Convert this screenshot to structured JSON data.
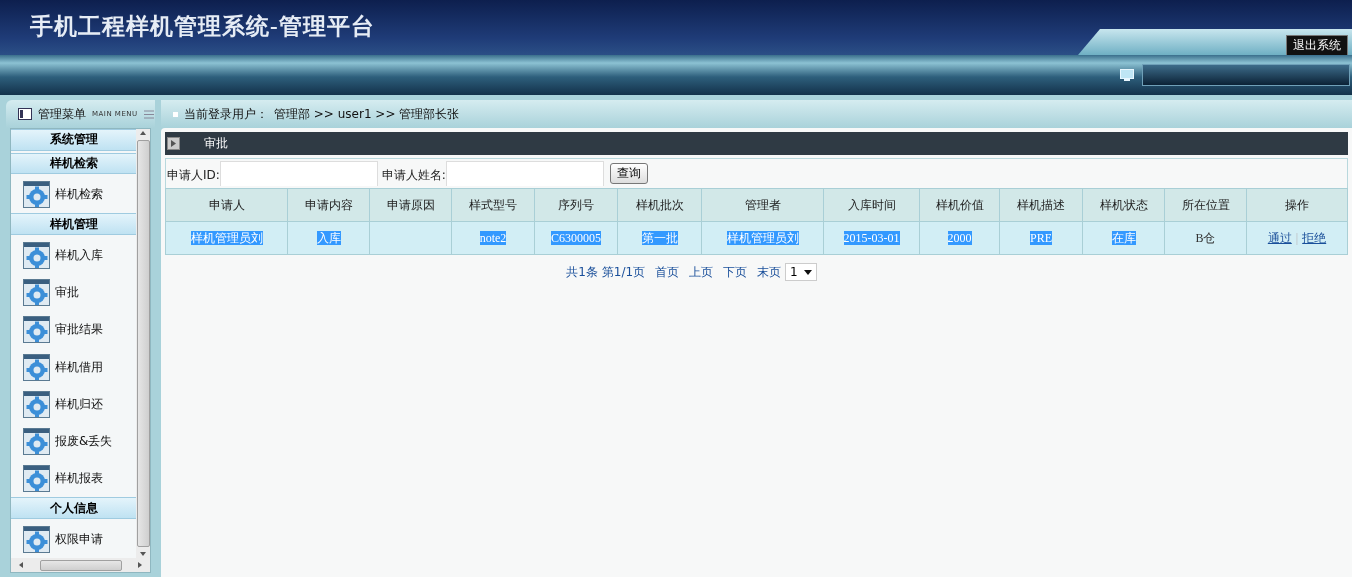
{
  "header": {
    "title": "手机工程样机管理系统-管理平台",
    "logout_button": "退出系统"
  },
  "menu": {
    "title": "管理菜单",
    "subtitle": "MAIN MENU"
  },
  "breadcrumb": {
    "label": "当前登录用户：",
    "path": "管理部  >> user1 >> 管理部长张"
  },
  "sidebar": {
    "sections": [
      {
        "title": "系统管理"
      },
      {
        "title": "样机检索",
        "items": [
          "样机检索"
        ]
      },
      {
        "title": "样机管理",
        "items": [
          "样机入库",
          "审批",
          "审批结果",
          "样机借用",
          "样机归还",
          "报废&丢失",
          "样机报表"
        ]
      },
      {
        "title": "个人信息",
        "items": [
          "权限申请"
        ]
      }
    ]
  },
  "panel": {
    "title": "审批"
  },
  "search": {
    "fields": [
      {
        "label": "申请人ID:"
      },
      {
        "label": "申请人姓名:"
      }
    ],
    "button": "查询"
  },
  "table": {
    "columns": [
      "申请人",
      "申请内容",
      "申请原因",
      "样式型号",
      "序列号",
      "样机批次",
      "管理者",
      "入库时间",
      "样机价值",
      "样机描述",
      "样机状态",
      "所在位置",
      "操作"
    ],
    "rows": [
      {
        "cells": [
          {
            "text": "样机管理员刘",
            "highlighted": true
          },
          {
            "text": "入库",
            "highlighted": true
          },
          {},
          {
            "text": "note2",
            "highlighted": true
          },
          {
            "text": "C6300005",
            "highlighted": true
          },
          {
            "text": "第一批",
            "highlighted": true
          },
          {
            "text": "样机管理员刘",
            "highlighted": true
          },
          {
            "text": "2015-03-01",
            "highlighted": true
          },
          {
            "text": "2000",
            "highlighted": true
          },
          {
            "text": "PRE",
            "highlighted": true
          },
          {
            "text": "在库",
            "highlighted": true
          },
          {
            "text": "B仓",
            "highlighted": false
          }
        ],
        "actions": [
          "通过",
          "拒绝"
        ],
        "separator": "|"
      }
    ]
  },
  "pager": {
    "summary": "共1条  第1/1页",
    "links": [
      "首页",
      "上页",
      "下页",
      "末页"
    ],
    "page_select": "1"
  }
}
